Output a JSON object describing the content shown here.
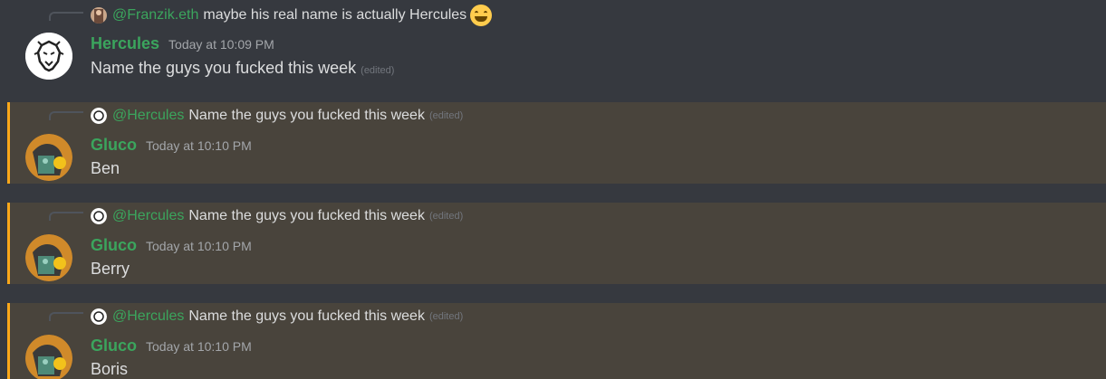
{
  "messages": [
    {
      "reply": {
        "mention": "@Franzik.eth",
        "text": "maybe his real name is actually Hercules",
        "edited": "",
        "emoji": "grinning-smiling-eyes-emoji"
      },
      "username": "Hercules",
      "timestamp": "Today at 10:09 PM",
      "content": "Name the guys you fucked this week",
      "edited": "(edited)",
      "avatar": "lion-logo-avatar",
      "highlighted": false
    },
    {
      "reply": {
        "mention": "@Hercules",
        "text": "Name the guys you fucked this week",
        "edited": "(edited)"
      },
      "username": "Gluco",
      "timestamp": "Today at 10:10 PM",
      "content": "Ben",
      "avatar": "gluco-avatar",
      "highlighted": true
    },
    {
      "reply": {
        "mention": "@Hercules",
        "text": "Name the guys you fucked this week",
        "edited": "(edited)"
      },
      "username": "Gluco",
      "timestamp": "Today at 10:10 PM",
      "content": "Berry",
      "avatar": "gluco-avatar",
      "highlighted": true
    },
    {
      "reply": {
        "mention": "@Hercules",
        "text": "Name the guys you fucked this week",
        "edited": "(edited)"
      },
      "username": "Gluco",
      "timestamp": "Today at 10:10 PM",
      "content": "Boris",
      "avatar": "gluco-avatar",
      "highlighted": true
    }
  ],
  "colors": {
    "background": "#36393f",
    "mention_highlight": "#49443c",
    "mention_bar": "#faa81a",
    "username": "#3ba55d"
  }
}
